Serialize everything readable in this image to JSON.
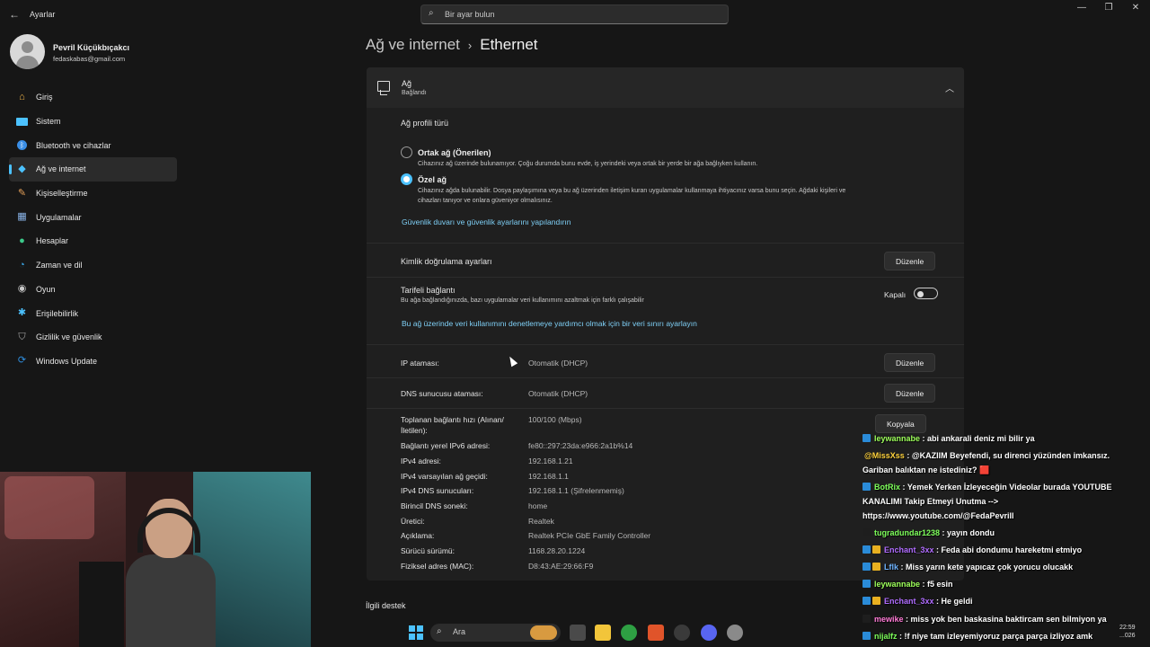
{
  "titlebar": {
    "app_title": "Ayarlar",
    "search_placeholder": "Bir ayar bulun"
  },
  "profile": {
    "name": "Pevril Küçükbıçakcı",
    "email": "fedaskabas@gmail.com"
  },
  "sidebar": {
    "items": [
      {
        "label": "Giriş",
        "icon": "home-icon",
        "color": "#f0b54a"
      },
      {
        "label": "Sistem",
        "icon": "system-icon",
        "color": "#4cc2ff"
      },
      {
        "label": "Bluetooth ve cihazlar",
        "icon": "bluetooth-icon",
        "color": "#3a8ee6"
      },
      {
        "label": "Ağ ve internet",
        "icon": "network-icon",
        "color": "#4cc2ff"
      },
      {
        "label": "Kişiselleştirme",
        "icon": "brush-icon",
        "color": "#e8a25a"
      },
      {
        "label": "Uygulamalar",
        "icon": "apps-icon",
        "color": "#8ab4e8"
      },
      {
        "label": "Hesaplar",
        "icon": "accounts-icon",
        "color": "#3cc98a"
      },
      {
        "label": "Zaman ve dil",
        "icon": "globe-clock-icon",
        "color": "#3aa6e6"
      },
      {
        "label": "Oyun",
        "icon": "gamepad-icon",
        "color": "#c8c8c8"
      },
      {
        "label": "Erişilebilirlik",
        "icon": "accessibility-icon",
        "color": "#4cc2ff"
      },
      {
        "label": "Gizlilik ve güvenlik",
        "icon": "shield-icon",
        "color": "#a8a8a8"
      },
      {
        "label": "Windows Update",
        "icon": "update-icon",
        "color": "#2f8fe0"
      }
    ]
  },
  "header": {
    "breadcrumb_parent": "Ağ ve internet",
    "breadcrumb_current": "Ethernet"
  },
  "card": {
    "title": "Ağ",
    "subtitle": "Bağlandı",
    "profile_type_label": "Ağ profili türü",
    "public_title": "Ortak ağ (Önerilen)",
    "public_desc": "Cihazınız ağ üzerinde bulunamıyor. Çoğu durumda bunu evde, iş yerindeki veya ortak bir yerde bir ağa bağlıyken kullanın.",
    "private_title": "Özel ağ",
    "private_desc_1": "Cihazınız ağda bulunabilir. Dosya paylaşımına veya bu ağ üzerinden iletişim kuran uygulamalar kullanmaya ihtiyacınız varsa bunu seçin. Ağdaki kişileri ve",
    "private_desc_2": "cihazları tanıyor ve onlara güveniyor olmalısınız.",
    "firewall_link": "Güvenlik duvarı ve güvenlik ayarlarını yapılandırın",
    "auth_label": "Kimlik doğrulama ayarları",
    "edit_label": "Düzenle",
    "metered_title": "Tarifeli bağlantı",
    "metered_desc": "Bu ağa bağlandığınızda, bazı uygulamalar veri kullanımını azaltmak için farklı çalışabilir",
    "metered_state": "Kapalı",
    "data_limit_link": "Bu ağ üzerinde veri kullanımını denetlemeye yardımcı olmak için bir veri sınırı ayarlayın",
    "ip_label": "IP ataması:",
    "ip_value": "Otomatik (DHCP)",
    "dns_label": "DNS sunucusu ataması:",
    "dns_value": "Otomatik (DHCP)",
    "copy_label": "Kopyala",
    "properties": [
      {
        "label": "Toplanan bağlantı hızı (Alınan/",
        "label2": "İletilen):",
        "value": "100/100 (Mbps)"
      },
      {
        "label": "Bağlantı yerel IPv6 adresi:",
        "value": "fe80::297:23da:e966:2a1b%14"
      },
      {
        "label": "IPv4 adresi:",
        "value": "192.168.1.21"
      },
      {
        "label": "IPv4 varsayılan ağ geçidi:",
        "value": "192.168.1.1"
      },
      {
        "label": "IPv4 DNS sunucuları:",
        "value": "192.168.1.1 (Şifrelenmemiş)"
      },
      {
        "label": "Birincil DNS soneki:",
        "value": "home"
      },
      {
        "label": "Üretici:",
        "value": "Realtek"
      },
      {
        "label": "Açıklama:",
        "value": "Realtek PCIe GbE Family Controller"
      },
      {
        "label": "Sürücü sürümü:",
        "value": "1168.28.20.1224"
      },
      {
        "label": "Fiziksel adres (MAC):",
        "value": "D8:43:AE:29:66:F9"
      }
    ]
  },
  "related": "İlgili destek",
  "chat": [
    {
      "user": "leywannabe",
      "color": "#9dff5a",
      "text": ": abi ankarali deniz mi bilir ya"
    },
    {
      "user": "@MissXss",
      "color": "#ffd23c",
      "text": ": @KAZIIM Beyefendi, su direnci yüzünden imkansız.",
      "text2": "Gariban balıktan ne istediniz? 🟥"
    },
    {
      "user": "BotRix",
      "color": "#7dff5a",
      "text": ": Yemek Yerken İzleyeceğin Videolar burada YOUTUBE",
      "text2": "KANALIMI Takip Etmeyi Unutma -->",
      "text3": "https://www.youtube.com/@FedaPevrill"
    },
    {
      "user": "tugradundar1238",
      "color": "#7dff5a",
      "text": ": yayın dondu"
    },
    {
      "user": "Enchant_3xx",
      "color": "#b06cff",
      "text": ": Feda abi dondumu hareketmi etmiyo"
    },
    {
      "user": "Lflk",
      "color": "#6fb4ff",
      "text": ": Miss yarın kete yapıcaz çok yorucu olucakk"
    },
    {
      "user": "leywannabe",
      "color": "#9dff5a",
      "text": ": f5 esin"
    },
    {
      "user": "Enchant_3xx",
      "color": "#b06cff",
      "text": ": He geldi"
    },
    {
      "user": "mewike",
      "color": "#ff7ad6",
      "text": ": miss yok ben baskasina baktircam sen bilmiyon ya"
    },
    {
      "user": "nijalfz",
      "color": "#7dff5a",
      "text": ": !f niye tam izleyemiyoruz parça parça izliyoz amk"
    }
  ],
  "taskbar": {
    "search_label": "Ara",
    "time": "22:59",
    "date": "...026"
  }
}
